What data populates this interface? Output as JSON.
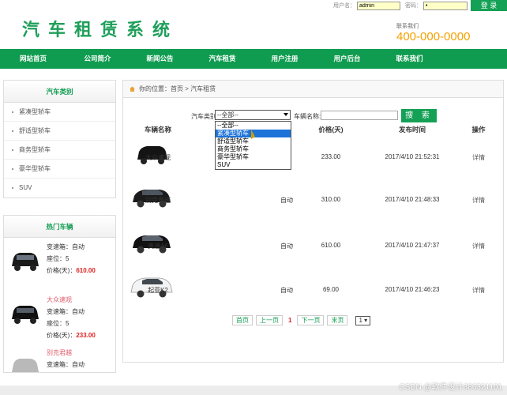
{
  "header": {
    "site_title": "汽车租赁系统",
    "login": {
      "username_label": "用户名：",
      "username_value": "admin",
      "password_label": "密码：",
      "password_value": "•",
      "login_button": "登 录"
    },
    "contact_label": "联系我们",
    "phone": "400-000-0000"
  },
  "nav": {
    "items": [
      "网站首页",
      "公司简介",
      "新闻公告",
      "汽车租赁",
      "用户注册",
      "用户后台",
      "联系我们"
    ]
  },
  "sidebar": {
    "categories_title": "汽车类别",
    "categories": [
      "紧凑型轿车",
      "舒适型轿车",
      "商务型轿车",
      "豪华型轿车",
      "SUV"
    ],
    "hot_title": "热门车辆",
    "hot_cars": [
      {
        "name": "",
        "transmission": "变速箱：自动",
        "seats": "座位：5",
        "price_label": "价格(天)：",
        "price": "610.00"
      },
      {
        "name": "大众速观",
        "transmission": "变速箱：自动",
        "seats": "座位：5",
        "price_label": "价格(天)：",
        "price": "233.00"
      },
      {
        "name": "别克君越",
        "transmission": "变速箱：自动",
        "seats": "",
        "price_label": "",
        "price": ""
      }
    ]
  },
  "main": {
    "breadcrumb": "你的位置：首页 > 汽车租赁",
    "search": {
      "category_label": "汽车类别",
      "category_selected": "--全部--",
      "name_label": "车辆名称:",
      "search_button": "搜 索",
      "options": [
        "--全部--",
        "紧凑型轿车",
        "舒适型轿车",
        "商务型轿车",
        "豪华型轿车",
        "SUV"
      ],
      "highlighted_option": "紧凑型轿车"
    },
    "columns": [
      "车辆名称",
      "",
      "箱",
      "价格(天)",
      "发布时间",
      "操作"
    ],
    "rows": [
      {
        "name": "大众速观",
        "transmission": "",
        "price": "233.00",
        "time": "2017/4/10 21:52:31",
        "action": "详情"
      },
      {
        "name": "别克君越",
        "transmission": "自动",
        "price": "310.00",
        "time": "2017/4/10 21:48:33",
        "action": "详情"
      },
      {
        "name": "奥迪A6",
        "transmission": "自动",
        "price": "610.00",
        "time": "2017/4/10 21:47:37",
        "action": "详情"
      },
      {
        "name": "起亚K2",
        "transmission": "自动",
        "price": "69.00",
        "time": "2017/4/10 21:46:23",
        "action": "详情"
      }
    ],
    "pager": {
      "first": "首页",
      "prev": "上一页",
      "current": "1",
      "next": "下一页",
      "last": "末页",
      "page_select": "1"
    }
  },
  "watermark": "CSDN @软件设计386321101",
  "colors": {
    "brand_green": "#109c50",
    "accent_orange": "#f5a100",
    "price_red": "#e02020",
    "highlight_blue": "#1e73d8"
  }
}
